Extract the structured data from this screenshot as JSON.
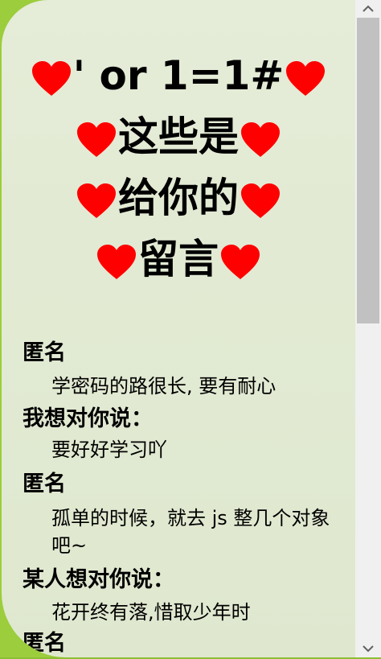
{
  "title": {
    "line1": "' or 1=1#",
    "line2": "这些是",
    "line3": "给你的",
    "line4": "留言"
  },
  "messages": [
    {
      "author": "匿名",
      "text": [
        "学密码的路很长, 要有耐心"
      ]
    },
    {
      "author": "我想对你说：",
      "text": [
        "要好好学习吖"
      ]
    },
    {
      "author": "匿名",
      "text": [
        "孤单的时候，就去 js 整几个对象",
        "吧~"
      ]
    },
    {
      "author": "某人想对你说：",
      "text": [
        "花开终有落,惜取少年时"
      ]
    },
    {
      "author": "匿名",
      "text": []
    }
  ],
  "icons": {
    "heart": "heart-icon",
    "scroll_up": "chevron-up-icon",
    "scroll_down": "chevron-down-icon"
  },
  "colors": {
    "heart": "#ff0000",
    "background": "#9bcd3c",
    "card": "#e2ead3"
  }
}
